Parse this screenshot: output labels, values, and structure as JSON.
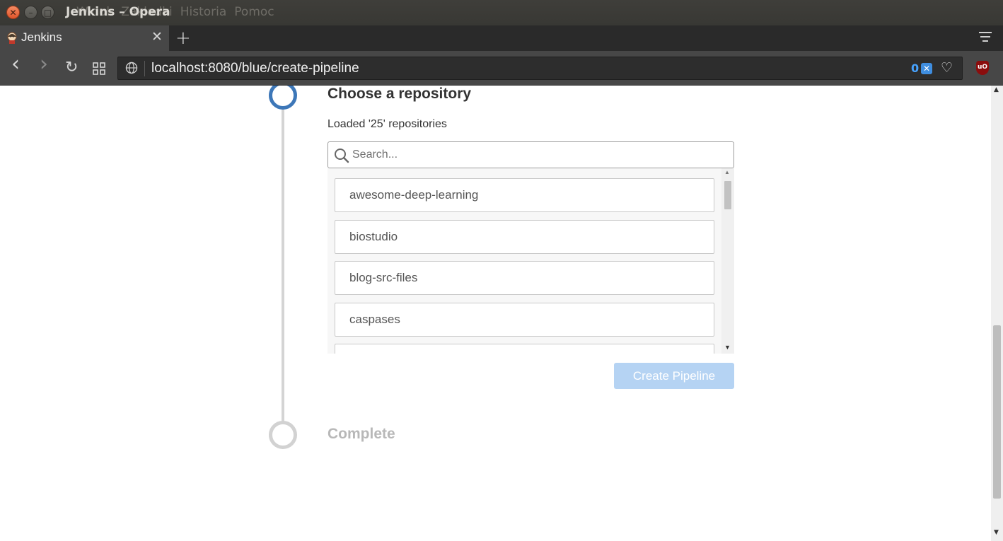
{
  "window": {
    "title": "Jenkins – Opera",
    "menu": [
      "Widok",
      "Zakładki",
      "Historia",
      "Pomoc"
    ],
    "close_glyph": "✕",
    "min_glyph": "–",
    "max_glyph": "□"
  },
  "tabs": [
    {
      "label": "Jenkins",
      "close_glyph": "✕"
    }
  ],
  "newtab_glyph": "+",
  "addressbar": {
    "back_glyph": "‹",
    "forward_glyph": "›",
    "reload_glyph": "↻",
    "url": "localhost:8080/blue/create-pipeline",
    "blocked_count": "0",
    "shield_glyph": "✕",
    "heart_glyph": "♡",
    "ublock_label": "uO"
  },
  "wizard": {
    "active_step": {
      "title": "Choose a repository"
    },
    "loaded_text": "Loaded '25' repositories",
    "search": {
      "placeholder": "Search...",
      "value": ""
    },
    "repositories": [
      "awesome-deep-learning",
      "biostudio",
      "blog-src-files",
      "caspases",
      "..."
    ],
    "create_button": "Create Pipeline",
    "next_step": {
      "title": "Complete"
    }
  },
  "scroll_glyphs": {
    "up": "▲",
    "down": "▼"
  },
  "colors": {
    "active_step": "#3d77b8",
    "inactive_step": "#d2d2d2",
    "create_button_disabled": "#b5d3f3"
  }
}
